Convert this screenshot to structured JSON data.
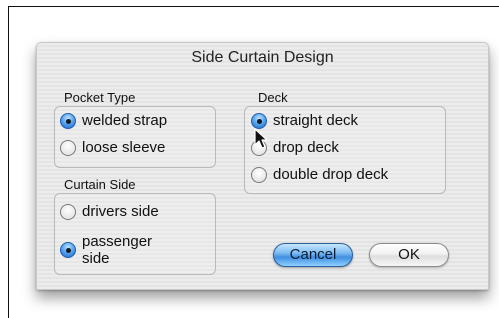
{
  "dialog": {
    "title": "Side Curtain Design",
    "pocket_type": {
      "label": "Pocket Type",
      "options": [
        {
          "label": "welded strap",
          "selected": true
        },
        {
          "label": "loose sleeve",
          "selected": false
        }
      ]
    },
    "curtain_side": {
      "label": "Curtain Side",
      "options": [
        {
          "label": "drivers side",
          "selected": false
        },
        {
          "label_line1": "passenger",
          "label_line2": "side",
          "selected": true
        }
      ]
    },
    "deck": {
      "label": "Deck",
      "options": [
        {
          "label": "straight deck",
          "selected": true
        },
        {
          "label": "drop deck",
          "selected": false
        },
        {
          "label": "double drop deck",
          "selected": false
        }
      ]
    },
    "buttons": {
      "cancel": "Cancel",
      "ok": "OK"
    }
  },
  "colors": {
    "accent": "#3f8fe2",
    "dialog_bg": "#e8e8e8"
  },
  "icons": {
    "cursor": "arrow-pointer-icon",
    "radio_on": "radio-selected-icon",
    "radio_off": "radio-unselected-icon"
  }
}
